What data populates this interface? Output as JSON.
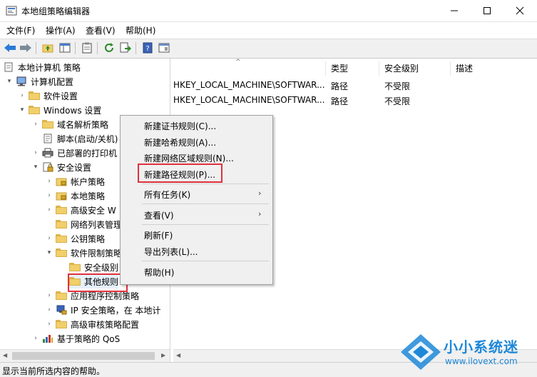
{
  "window": {
    "title": "本地组策略编辑器"
  },
  "menubar": [
    "文件(F)",
    "操作(A)",
    "查看(V)",
    "帮助(H)"
  ],
  "tree": {
    "root": "本地计算机 策略",
    "computer_config": "计算机配置",
    "software_settings": "软件设置",
    "windows_settings": "Windows 设置",
    "dns_policy": "域名解析策略",
    "scripts": "脚本(启动/关机)",
    "printers": "已部署的打印机",
    "security_settings": "安全设置",
    "account_policy": "帐户策略",
    "local_policy": "本地策略",
    "advanced_firewall": "高级安全 W",
    "network_list": "网络列表管理",
    "public_key": "公钥策略",
    "software_restriction": "软件限制策略",
    "security_levels": "安全级别",
    "other_rules": "其他规则",
    "applocker": "应用程序控制策略",
    "ipsec": "IP 安全策略，在 本地计",
    "advanced_audit": "高级审核策略配置",
    "qos": "基于策略的 QoS"
  },
  "list": {
    "columns": [
      "类型",
      "安全级别",
      "描述"
    ],
    "rows": [
      {
        "name": "HKEY_LOCAL_MACHINE\\SOFTWAR...",
        "type": "路径",
        "level": "不受限"
      },
      {
        "name": "HKEY_LOCAL_MACHINE\\SOFTWAR...",
        "type": "路径",
        "level": "不受限"
      }
    ]
  },
  "context_menu": {
    "new_cert_rule": "新建证书规则(C)...",
    "new_hash_rule": "新建哈希规则(A)...",
    "new_zone_rule": "新建网络区域规则(N)...",
    "new_path_rule": "新建路径规则(P)...",
    "all_tasks": "所有任务(K)",
    "view": "查看(V)",
    "refresh": "刷新(F)",
    "export_list": "导出列表(L)...",
    "help": "帮助(H)"
  },
  "status": "显示当前所选内容的帮助。",
  "watermark": {
    "brand": "小小系统迷",
    "url": "www.ilovext.com"
  },
  "colors": {
    "highlight_box": "#e0313c",
    "folder": "#f1cf6a",
    "watermark_blue": "#1e88d8"
  }
}
